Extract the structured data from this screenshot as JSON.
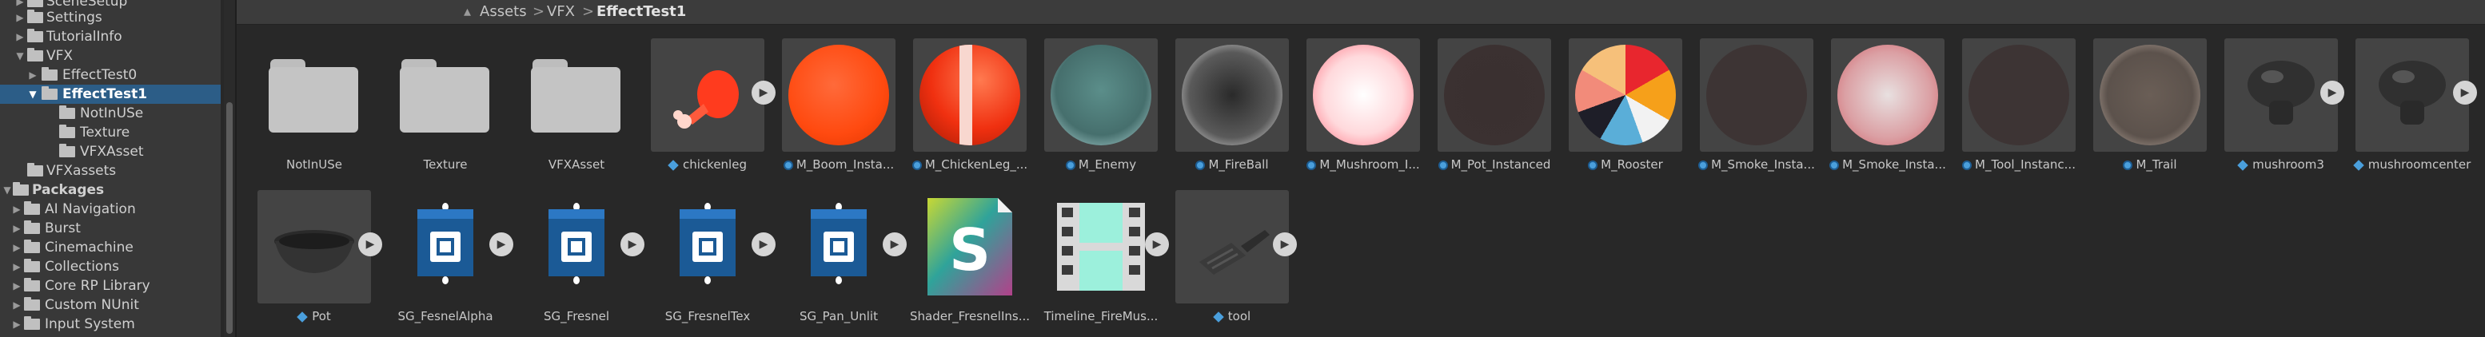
{
  "tree": {
    "items": [
      {
        "label": "SceneSetup",
        "indent": 1,
        "expanded": false
      },
      {
        "label": "Settings",
        "indent": 1,
        "expanded": false
      },
      {
        "label": "TutorialInfo",
        "indent": 1,
        "expanded": false
      },
      {
        "label": "VFX",
        "indent": 1,
        "expanded": true
      },
      {
        "label": "EffectTest0",
        "indent": 2,
        "expanded": false
      },
      {
        "label": "EffectTest1",
        "indent": 2,
        "expanded": true,
        "selected": true
      },
      {
        "label": "NotInUSe",
        "indent": 3
      },
      {
        "label": "Texture",
        "indent": 3
      },
      {
        "label": "VFXAsset",
        "indent": 3
      },
      {
        "label": "VFXassets",
        "indent": 1
      },
      {
        "label": "Packages",
        "indent": 0,
        "expanded": true,
        "bold": true
      },
      {
        "label": "AI Navigation",
        "indent": 1,
        "expanded": false
      },
      {
        "label": "Burst",
        "indent": 1,
        "expanded": false
      },
      {
        "label": "Cinemachine",
        "indent": 1,
        "expanded": false
      },
      {
        "label": "Collections",
        "indent": 1,
        "expanded": false
      },
      {
        "label": "Core RP Library",
        "indent": 1,
        "expanded": false
      },
      {
        "label": "Custom NUnit",
        "indent": 1,
        "expanded": false
      },
      {
        "label": "Input System",
        "indent": 1,
        "expanded": false
      }
    ]
  },
  "breadcrumb": {
    "items": [
      "Assets",
      "VFX",
      "EffectTest1"
    ],
    "separator": ">"
  },
  "assets": {
    "row1": [
      {
        "label": "NotInUSe",
        "kind": "folder"
      },
      {
        "label": "Texture",
        "kind": "folder"
      },
      {
        "label": "VFXAsset",
        "kind": "folder"
      },
      {
        "label": "chickenleg",
        "kind": "model",
        "icon": "prefab-icon",
        "expandable": true
      },
      {
        "label": "M_Boom_Insta...",
        "kind": "material",
        "icon": "material-icon"
      },
      {
        "label": "M_ChickenLeg_...",
        "kind": "material",
        "icon": "material-icon"
      },
      {
        "label": "M_Enemy",
        "kind": "material",
        "icon": "material-icon"
      },
      {
        "label": "M_FireBall",
        "kind": "material",
        "icon": "material-icon"
      },
      {
        "label": "M_Mushroom_I...",
        "kind": "material",
        "icon": "material-icon"
      },
      {
        "label": "M_Pot_Instanced",
        "kind": "material",
        "icon": "material-icon"
      },
      {
        "label": "M_Rooster",
        "kind": "material",
        "icon": "material-icon"
      },
      {
        "label": "M_Smoke_Insta...",
        "kind": "material",
        "icon": "material-icon"
      },
      {
        "label": "M_Smoke_Insta...",
        "kind": "material",
        "icon": "material-icon"
      },
      {
        "label": "M_Tool_Instanc...",
        "kind": "material",
        "icon": "material-icon"
      },
      {
        "label": "M_Trail",
        "kind": "material",
        "icon": "material-icon"
      },
      {
        "label": "mushroom3",
        "kind": "model",
        "icon": "prefab-icon",
        "expandable": true
      },
      {
        "label": "mushroomcenter",
        "kind": "model",
        "icon": "prefab-icon",
        "expandable": true
      }
    ],
    "row2": [
      {
        "label": "Pot",
        "kind": "model",
        "icon": "prefab-icon",
        "expandable": true
      },
      {
        "label": "SG_FesnelAlpha",
        "kind": "shadergraph",
        "expandable": true
      },
      {
        "label": "SG_Fresnel",
        "kind": "shadergraph",
        "expandable": true
      },
      {
        "label": "SG_FresnelTex",
        "kind": "shadergraph",
        "expandable": true
      },
      {
        "label": "SG_Pan_Unlit",
        "kind": "shadergraph",
        "expandable": true
      },
      {
        "label": "Shader_FresnelIns...",
        "kind": "shader"
      },
      {
        "label": "Timeline_FireMus...",
        "kind": "timeline",
        "expandable": true
      },
      {
        "label": "tool",
        "kind": "model",
        "icon": "prefab-icon",
        "expandable": true
      }
    ]
  },
  "colors": {
    "selection": "#2c5d87",
    "panel": "#383838",
    "grid_bg": "#282828"
  }
}
